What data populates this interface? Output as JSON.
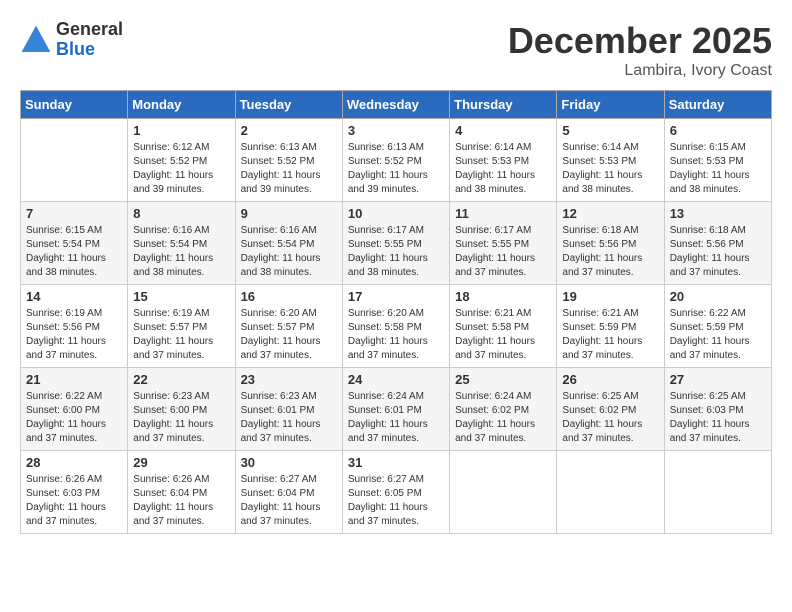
{
  "header": {
    "logo_general": "General",
    "logo_blue": "Blue",
    "month_title": "December 2025",
    "location": "Lambira, Ivory Coast"
  },
  "columns": [
    "Sunday",
    "Monday",
    "Tuesday",
    "Wednesday",
    "Thursday",
    "Friday",
    "Saturday"
  ],
  "weeks": [
    [
      {
        "day": "",
        "info": ""
      },
      {
        "day": "1",
        "info": "Sunrise: 6:12 AM\nSunset: 5:52 PM\nDaylight: 11 hours and 39 minutes."
      },
      {
        "day": "2",
        "info": "Sunrise: 6:13 AM\nSunset: 5:52 PM\nDaylight: 11 hours and 39 minutes."
      },
      {
        "day": "3",
        "info": "Sunrise: 6:13 AM\nSunset: 5:52 PM\nDaylight: 11 hours and 39 minutes."
      },
      {
        "day": "4",
        "info": "Sunrise: 6:14 AM\nSunset: 5:53 PM\nDaylight: 11 hours and 38 minutes."
      },
      {
        "day": "5",
        "info": "Sunrise: 6:14 AM\nSunset: 5:53 PM\nDaylight: 11 hours and 38 minutes."
      },
      {
        "day": "6",
        "info": "Sunrise: 6:15 AM\nSunset: 5:53 PM\nDaylight: 11 hours and 38 minutes."
      }
    ],
    [
      {
        "day": "7",
        "info": "Sunrise: 6:15 AM\nSunset: 5:54 PM\nDaylight: 11 hours and 38 minutes."
      },
      {
        "day": "8",
        "info": "Sunrise: 6:16 AM\nSunset: 5:54 PM\nDaylight: 11 hours and 38 minutes."
      },
      {
        "day": "9",
        "info": "Sunrise: 6:16 AM\nSunset: 5:54 PM\nDaylight: 11 hours and 38 minutes."
      },
      {
        "day": "10",
        "info": "Sunrise: 6:17 AM\nSunset: 5:55 PM\nDaylight: 11 hours and 38 minutes."
      },
      {
        "day": "11",
        "info": "Sunrise: 6:17 AM\nSunset: 5:55 PM\nDaylight: 11 hours and 37 minutes."
      },
      {
        "day": "12",
        "info": "Sunrise: 6:18 AM\nSunset: 5:56 PM\nDaylight: 11 hours and 37 minutes."
      },
      {
        "day": "13",
        "info": "Sunrise: 6:18 AM\nSunset: 5:56 PM\nDaylight: 11 hours and 37 minutes."
      }
    ],
    [
      {
        "day": "14",
        "info": "Sunrise: 6:19 AM\nSunset: 5:56 PM\nDaylight: 11 hours and 37 minutes."
      },
      {
        "day": "15",
        "info": "Sunrise: 6:19 AM\nSunset: 5:57 PM\nDaylight: 11 hours and 37 minutes."
      },
      {
        "day": "16",
        "info": "Sunrise: 6:20 AM\nSunset: 5:57 PM\nDaylight: 11 hours and 37 minutes."
      },
      {
        "day": "17",
        "info": "Sunrise: 6:20 AM\nSunset: 5:58 PM\nDaylight: 11 hours and 37 minutes."
      },
      {
        "day": "18",
        "info": "Sunrise: 6:21 AM\nSunset: 5:58 PM\nDaylight: 11 hours and 37 minutes."
      },
      {
        "day": "19",
        "info": "Sunrise: 6:21 AM\nSunset: 5:59 PM\nDaylight: 11 hours and 37 minutes."
      },
      {
        "day": "20",
        "info": "Sunrise: 6:22 AM\nSunset: 5:59 PM\nDaylight: 11 hours and 37 minutes."
      }
    ],
    [
      {
        "day": "21",
        "info": "Sunrise: 6:22 AM\nSunset: 6:00 PM\nDaylight: 11 hours and 37 minutes."
      },
      {
        "day": "22",
        "info": "Sunrise: 6:23 AM\nSunset: 6:00 PM\nDaylight: 11 hours and 37 minutes."
      },
      {
        "day": "23",
        "info": "Sunrise: 6:23 AM\nSunset: 6:01 PM\nDaylight: 11 hours and 37 minutes."
      },
      {
        "day": "24",
        "info": "Sunrise: 6:24 AM\nSunset: 6:01 PM\nDaylight: 11 hours and 37 minutes."
      },
      {
        "day": "25",
        "info": "Sunrise: 6:24 AM\nSunset: 6:02 PM\nDaylight: 11 hours and 37 minutes."
      },
      {
        "day": "26",
        "info": "Sunrise: 6:25 AM\nSunset: 6:02 PM\nDaylight: 11 hours and 37 minutes."
      },
      {
        "day": "27",
        "info": "Sunrise: 6:25 AM\nSunset: 6:03 PM\nDaylight: 11 hours and 37 minutes."
      }
    ],
    [
      {
        "day": "28",
        "info": "Sunrise: 6:26 AM\nSunset: 6:03 PM\nDaylight: 11 hours and 37 minutes."
      },
      {
        "day": "29",
        "info": "Sunrise: 6:26 AM\nSunset: 6:04 PM\nDaylight: 11 hours and 37 minutes."
      },
      {
        "day": "30",
        "info": "Sunrise: 6:27 AM\nSunset: 6:04 PM\nDaylight: 11 hours and 37 minutes."
      },
      {
        "day": "31",
        "info": "Sunrise: 6:27 AM\nSunset: 6:05 PM\nDaylight: 11 hours and 37 minutes."
      },
      {
        "day": "",
        "info": ""
      },
      {
        "day": "",
        "info": ""
      },
      {
        "day": "",
        "info": ""
      }
    ]
  ]
}
